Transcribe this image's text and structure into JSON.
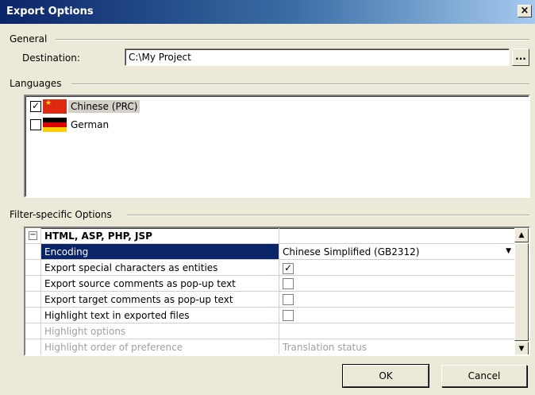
{
  "window": {
    "title": "Export Options",
    "close_glyph": "×"
  },
  "general": {
    "group_label": "General",
    "destination_label": "Destination:",
    "destination_value": "C:\\My Project",
    "browse_label": "..."
  },
  "languages": {
    "group_label": "Languages",
    "items": [
      {
        "label": "Chinese (PRC)",
        "checked": true,
        "flag": "flag-china-icon"
      },
      {
        "label": "German",
        "checked": false,
        "flag": "flag-germany-icon"
      }
    ]
  },
  "filter": {
    "group_label": "Filter-specific Options",
    "category": "HTML, ASP, PHP, JSP",
    "collapse_glyph": "−",
    "rows": [
      {
        "label": "Encoding",
        "value": "Chinese Simplified (GB2312)"
      },
      {
        "label": "Export special characters as entities",
        "value": "checked"
      },
      {
        "label": "Export source comments as pop-up text",
        "value": "unchecked"
      },
      {
        "label": "Export target comments as pop-up text",
        "value": "unchecked"
      },
      {
        "label": "Highlight text in exported files",
        "value": "unchecked"
      },
      {
        "label": "Highlight options",
        "value": ""
      },
      {
        "label": "Highlight order of preference",
        "value": "Translation status"
      }
    ]
  },
  "buttons": {
    "ok": "OK",
    "cancel": "Cancel"
  },
  "glyphs": {
    "check": "✓",
    "dropdown": "▼",
    "scroll_up": "▲",
    "scroll_down": "▼"
  },
  "colors": {
    "title_start": "#0a246a",
    "selection": "#0a246a",
    "face": "#ece9d8"
  }
}
